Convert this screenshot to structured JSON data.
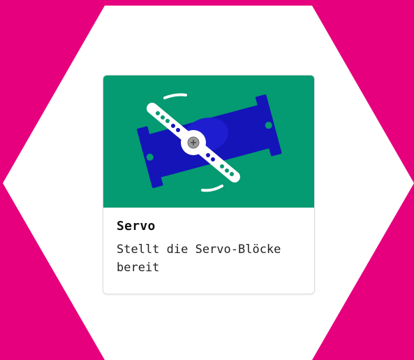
{
  "colors": {
    "background": "#e6007e",
    "hexagon": "#ffffff",
    "card_image_bg": "#049a72",
    "servo_body": "#1414b8",
    "servo_horn": "#ffffff"
  },
  "card": {
    "title": "Servo",
    "description": "Stellt die Servo-Blöcke bereit",
    "icon": "servo-motor-icon"
  }
}
